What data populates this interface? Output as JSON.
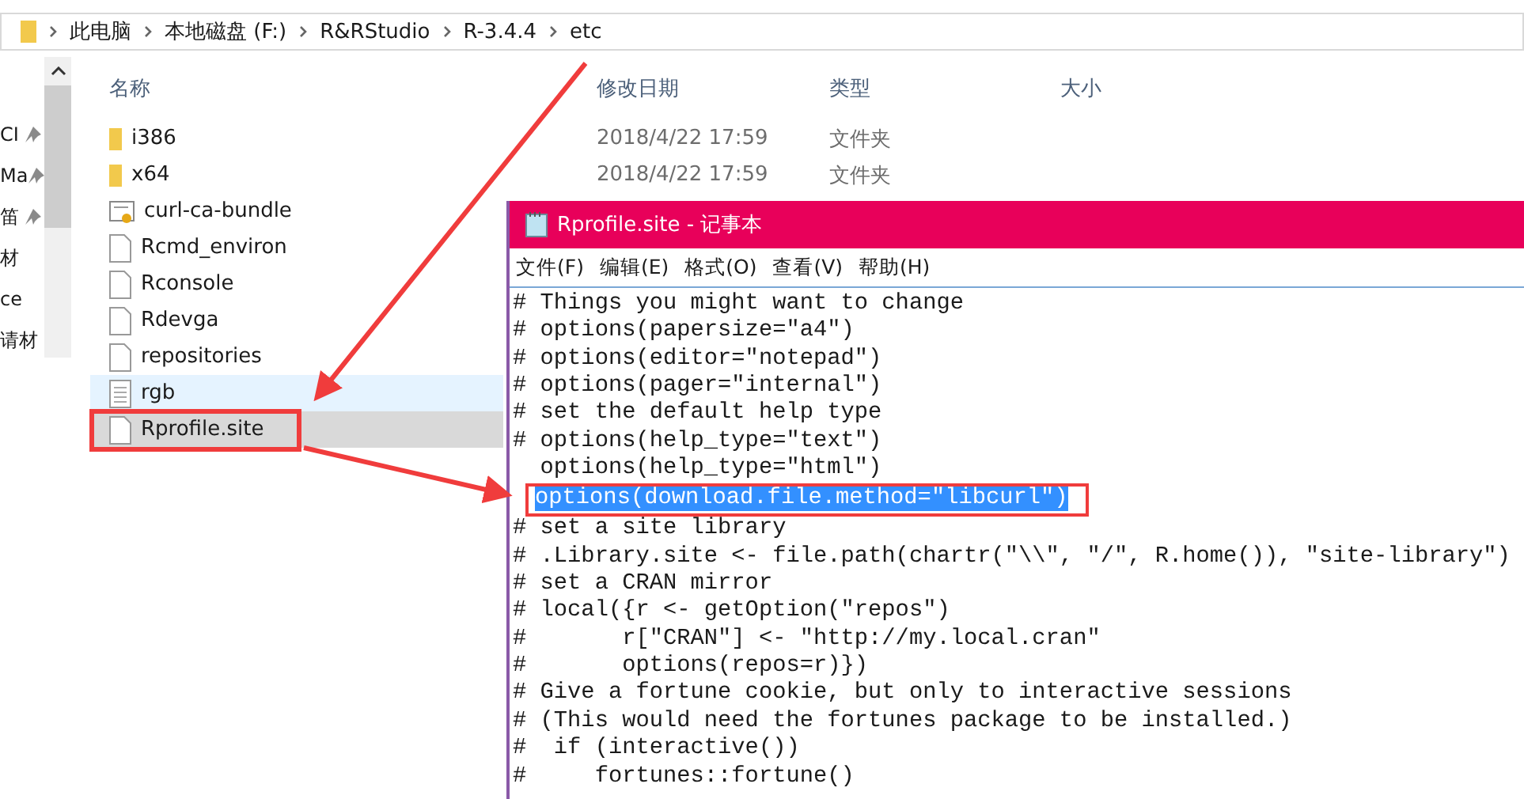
{
  "explorer": {
    "breadcrumbs": [
      "此电脑",
      "本地磁盘 (F:)",
      "R&RStudio",
      "R-3.4.4",
      "etc"
    ],
    "nav_items": [
      {
        "label": "CI",
        "pinned": true
      },
      {
        "label": "Ma",
        "pinned": true
      },
      {
        "label": "笛",
        "pinned": true
      },
      {
        "label": "材",
        "pinned": false
      },
      {
        "label": "ce",
        "pinned": false
      },
      {
        "label": "请材",
        "pinned": false
      }
    ],
    "columns": [
      "名称",
      "修改日期",
      "类型",
      "大小"
    ],
    "files": [
      {
        "name": "i386",
        "kind": "folder",
        "date": "2018/4/22 17:59",
        "type": "文件夹",
        "selected": false,
        "hover": false
      },
      {
        "name": "x64",
        "kind": "folder",
        "date": "2018/4/22 17:59",
        "type": "文件夹",
        "selected": false,
        "hover": false
      },
      {
        "name": "curl-ca-bundle",
        "kind": "certificate",
        "selected": false,
        "hover": false
      },
      {
        "name": "Rcmd_environ",
        "kind": "file",
        "selected": false,
        "hover": false
      },
      {
        "name": "Rconsole",
        "kind": "file",
        "selected": false,
        "hover": false
      },
      {
        "name": "Rdevga",
        "kind": "file",
        "selected": false,
        "hover": false
      },
      {
        "name": "repositories",
        "kind": "file",
        "selected": false,
        "hover": false
      },
      {
        "name": "rgb",
        "kind": "text",
        "selected": false,
        "hover": true
      },
      {
        "name": "Rprofile.site",
        "kind": "file",
        "selected": true,
        "hover": false
      }
    ]
  },
  "notepad": {
    "title": "Rprofile.site - 记事本",
    "menu": [
      "文件(F)",
      "编辑(E)",
      "格式(O)",
      "查看(V)",
      "帮助(H)"
    ],
    "lines": [
      {
        "text": "# Things you might want to change",
        "selected": false
      },
      {
        "text": "# options(papersize=\"a4\")",
        "selected": false
      },
      {
        "text": "# options(editor=\"notepad\")",
        "selected": false
      },
      {
        "text": "# options(pager=\"internal\")",
        "selected": false
      },
      {
        "text": "# set the default help type",
        "selected": false
      },
      {
        "text": "# options(help_type=\"text\")",
        "selected": false
      },
      {
        "text": "  options(help_type=\"html\")",
        "selected": false
      },
      {
        "text": "options(download.file.method=\"libcurl\")",
        "selected": true
      },
      {
        "text": "# set a site library",
        "selected": false
      },
      {
        "text": "# .Library.site <- file.path(chartr(\"\\\\\", \"/\", R.home()), \"site-library\")",
        "selected": false
      },
      {
        "text": "# set a CRAN mirror",
        "selected": false
      },
      {
        "text": "# local({r <- getOption(\"repos\")",
        "selected": false
      },
      {
        "text": "#       r[\"CRAN\"] <- \"http://my.local.cran\"",
        "selected": false
      },
      {
        "text": "#       options(repos=r)})",
        "selected": false
      },
      {
        "text": "# Give a fortune cookie, but only to interactive sessions",
        "selected": false
      },
      {
        "text": "# (This would need the fortunes package to be installed.)",
        "selected": false
      },
      {
        "text": "#  if (interactive())",
        "selected": false
      },
      {
        "text": "#     fortunes::fortune()",
        "selected": false
      }
    ]
  }
}
